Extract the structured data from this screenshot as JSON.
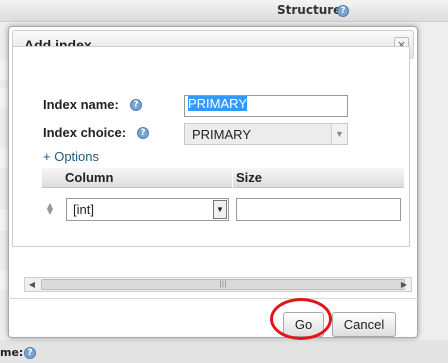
{
  "background": {
    "structure_label": "Structure",
    "bottom_fragment": "me:"
  },
  "dialog": {
    "title": "Add index",
    "close_glyph": "×",
    "index_name_label": "Index name:",
    "index_name_value": "PRIMARY",
    "index_choice_label": "Index choice:",
    "index_choice_value": "PRIMARY",
    "options_link": "+ Options",
    "column_header": "Column",
    "size_header": "Size",
    "column_value": "[int]",
    "size_value": "",
    "go_label": "Go",
    "cancel_label": "Cancel"
  },
  "icons": {
    "help": "help-icon",
    "close": "close-icon",
    "drag": "drag-handle-icon",
    "dropdown": "chevron-down-icon",
    "scroll_left": "chevron-left-icon",
    "scroll_right": "chevron-right-icon"
  },
  "colors": {
    "link": "#235a81",
    "selection": "#3399ff",
    "annotation_ring": "#e0161b",
    "help_icon": "#7aa3cf"
  }
}
